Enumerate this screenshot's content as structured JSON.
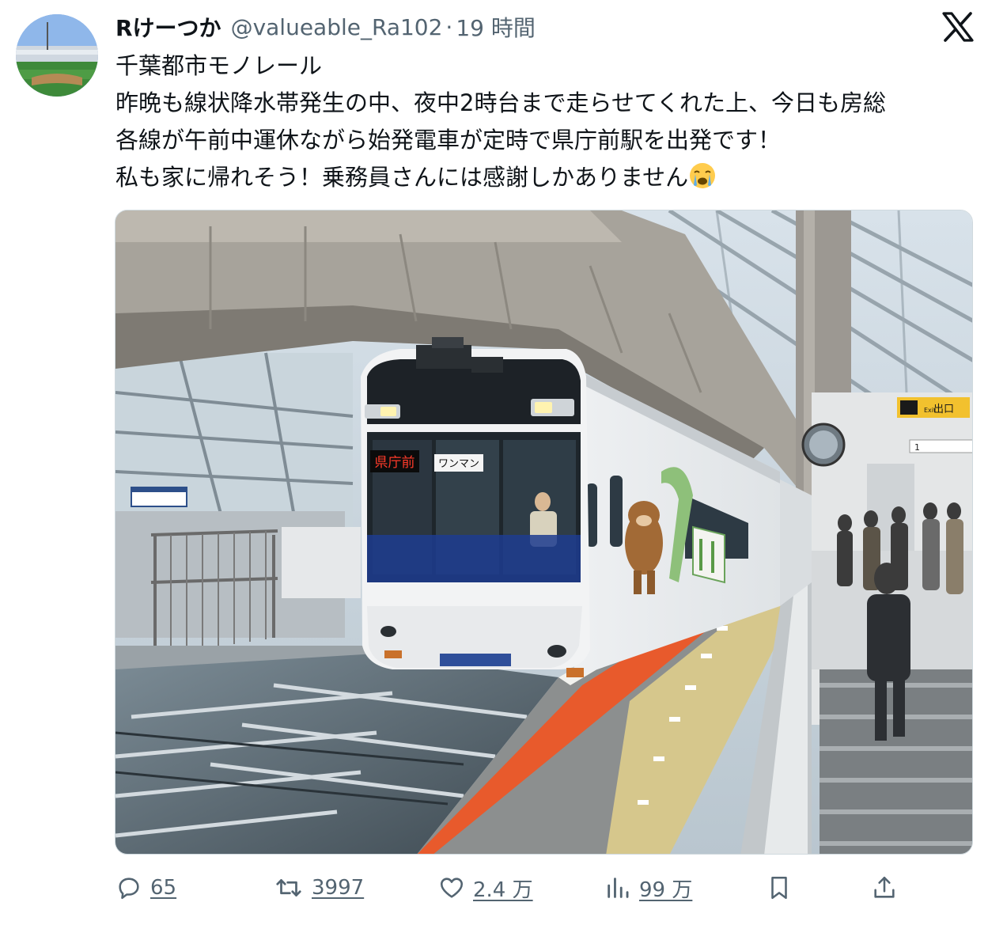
{
  "tweet": {
    "author": {
      "display_name": "Rけーつか",
      "handle": "@valueable_Ra102",
      "separator": "·",
      "time": "19 時間"
    },
    "body_lines": [
      "千葉都市モノレール",
      "昨晩も線状降水帯発生の中、夜中2時台まで走らせてくれた上、今日も房総",
      "各線が午前中運休ながら始発電車が定時で県庁前駅を出発です！",
      "私も家に帰れそう！乗務員さんには感謝しかありません"
    ],
    "emoji": "loudly-crying-face",
    "photo": {
      "destination_sign": "県庁前",
      "oneman_sign": "ワンマン",
      "exit_sign": "出口",
      "exit_sign_en": "Exit",
      "platform_number": "1"
    },
    "actions": {
      "replies": "65",
      "retweets": "3997",
      "likes": "2.4 万",
      "views": "99 万"
    }
  },
  "colors": {
    "text": "#0f1419",
    "secondary": "#536471",
    "platform_edge": "#e85a2c"
  },
  "icons": [
    "x-logo-icon",
    "reply-icon",
    "retweet-icon",
    "like-icon",
    "views-icon",
    "bookmark-icon",
    "share-icon"
  ]
}
